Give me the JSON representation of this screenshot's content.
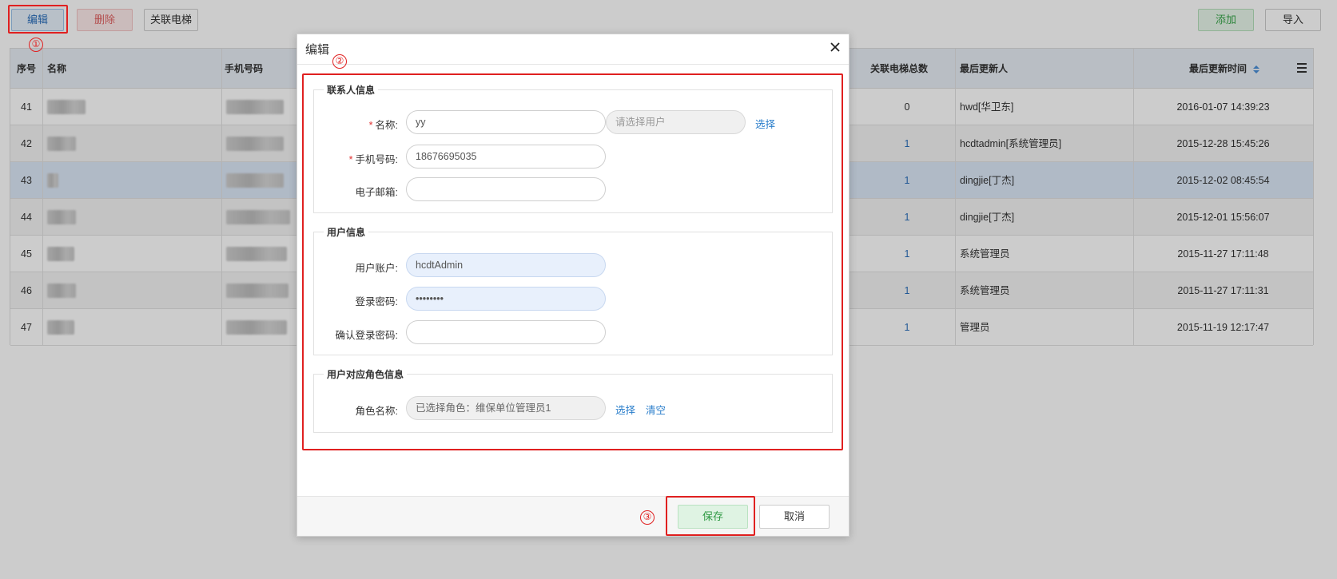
{
  "toolbar": {
    "edit": "编辑",
    "delete": "删除",
    "link_elevator": "关联电梯",
    "add": "添加",
    "import": "导入"
  },
  "table": {
    "headers": {
      "seq": "序号",
      "name": "名称",
      "phone": "手机号码",
      "elevator_total": "关联电梯总数",
      "updater": "最后更新人",
      "updated_at": "最后更新时间"
    },
    "rows": [
      {
        "seq": "41",
        "elevator_total": "0",
        "updater": "hwd[华卫东]",
        "updated_at": "2016-01-07 14:39:23"
      },
      {
        "seq": "42",
        "elevator_total": "1",
        "updater": "hcdtadmin[系统管理员]",
        "updated_at": "2015-12-28 15:45:26"
      },
      {
        "seq": "43",
        "elevator_total": "1",
        "updater": "dingjie[丁杰]",
        "updated_at": "2015-12-02 08:45:54"
      },
      {
        "seq": "44",
        "elevator_total": "1",
        "updater": "dingjie[丁杰]",
        "updated_at": "2015-12-01 15:56:07"
      },
      {
        "seq": "45",
        "elevator_total": "1",
        "updater": "系统管理员",
        "updated_at": "2015-11-27 17:11:48"
      },
      {
        "seq": "46",
        "elevator_total": "1",
        "updater": "系统管理员",
        "updated_at": "2015-11-27 17:11:31"
      },
      {
        "seq": "47",
        "elevator_total": "1",
        "updater": "管理员",
        "updated_at": "2015-11-19 12:17:47"
      }
    ]
  },
  "dialog": {
    "title": "编辑",
    "contact_section": {
      "legend": "联系人信息",
      "name_label": "名称:",
      "name_value": "yy",
      "user_select_placeholder": "请选择用户",
      "select_link": "选择",
      "phone_label": "手机号码:",
      "phone_value": "18676695035",
      "email_label": "电子邮箱:",
      "email_value": ""
    },
    "user_section": {
      "legend": "用户信息",
      "account_label": "用户账户:",
      "account_value": "hcdtAdmin",
      "password_label": "登录密码:",
      "password_value": "••••••••",
      "confirm_label": "确认登录密码:",
      "confirm_value": ""
    },
    "role_section": {
      "legend": "用户对应角色信息",
      "role_label": "角色名称:",
      "role_value": "已选择角色：维保单位管理员1",
      "select_link": "选择",
      "clear_link": "清空"
    },
    "save": "保存",
    "cancel": "取消"
  },
  "annotations": [
    "①",
    "②",
    "③"
  ],
  "colors": {
    "accent_red": "#e02020",
    "link_blue": "#2a7ecb",
    "save_green": "#2f9a44"
  }
}
